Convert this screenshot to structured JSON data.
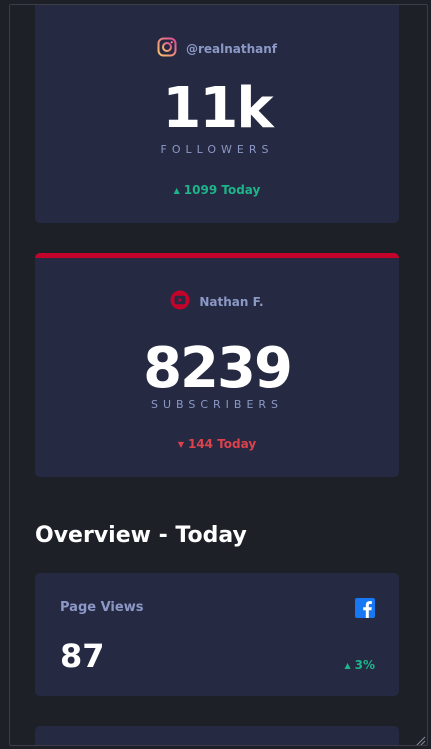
{
  "instagram": {
    "handle": "@realnathanf",
    "count": "11k",
    "unit": "FOLLOWERS",
    "today_change": "1099 Today",
    "trend": "up",
    "icon": "instagram-icon",
    "trend_color": "#1db489"
  },
  "youtube": {
    "handle": "Nathan F.",
    "count": "8239",
    "unit": "SUBSCRIBERS",
    "today_change": "144 Today",
    "trend": "down",
    "icon": "youtube-icon",
    "accent_color": "#c4032b",
    "trend_color": "#dc414c"
  },
  "overview": {
    "title": "Overview - Today",
    "cards": [
      {
        "label": "Page Views",
        "value": "87",
        "change": "3%",
        "trend": "up",
        "icon": "facebook-icon",
        "icon_color": "#1877f2"
      }
    ]
  },
  "colors": {
    "background": "#1e2028",
    "card": "#252a42",
    "muted_text": "#8c98c6",
    "up": "#1db489",
    "down": "#dc414c"
  }
}
